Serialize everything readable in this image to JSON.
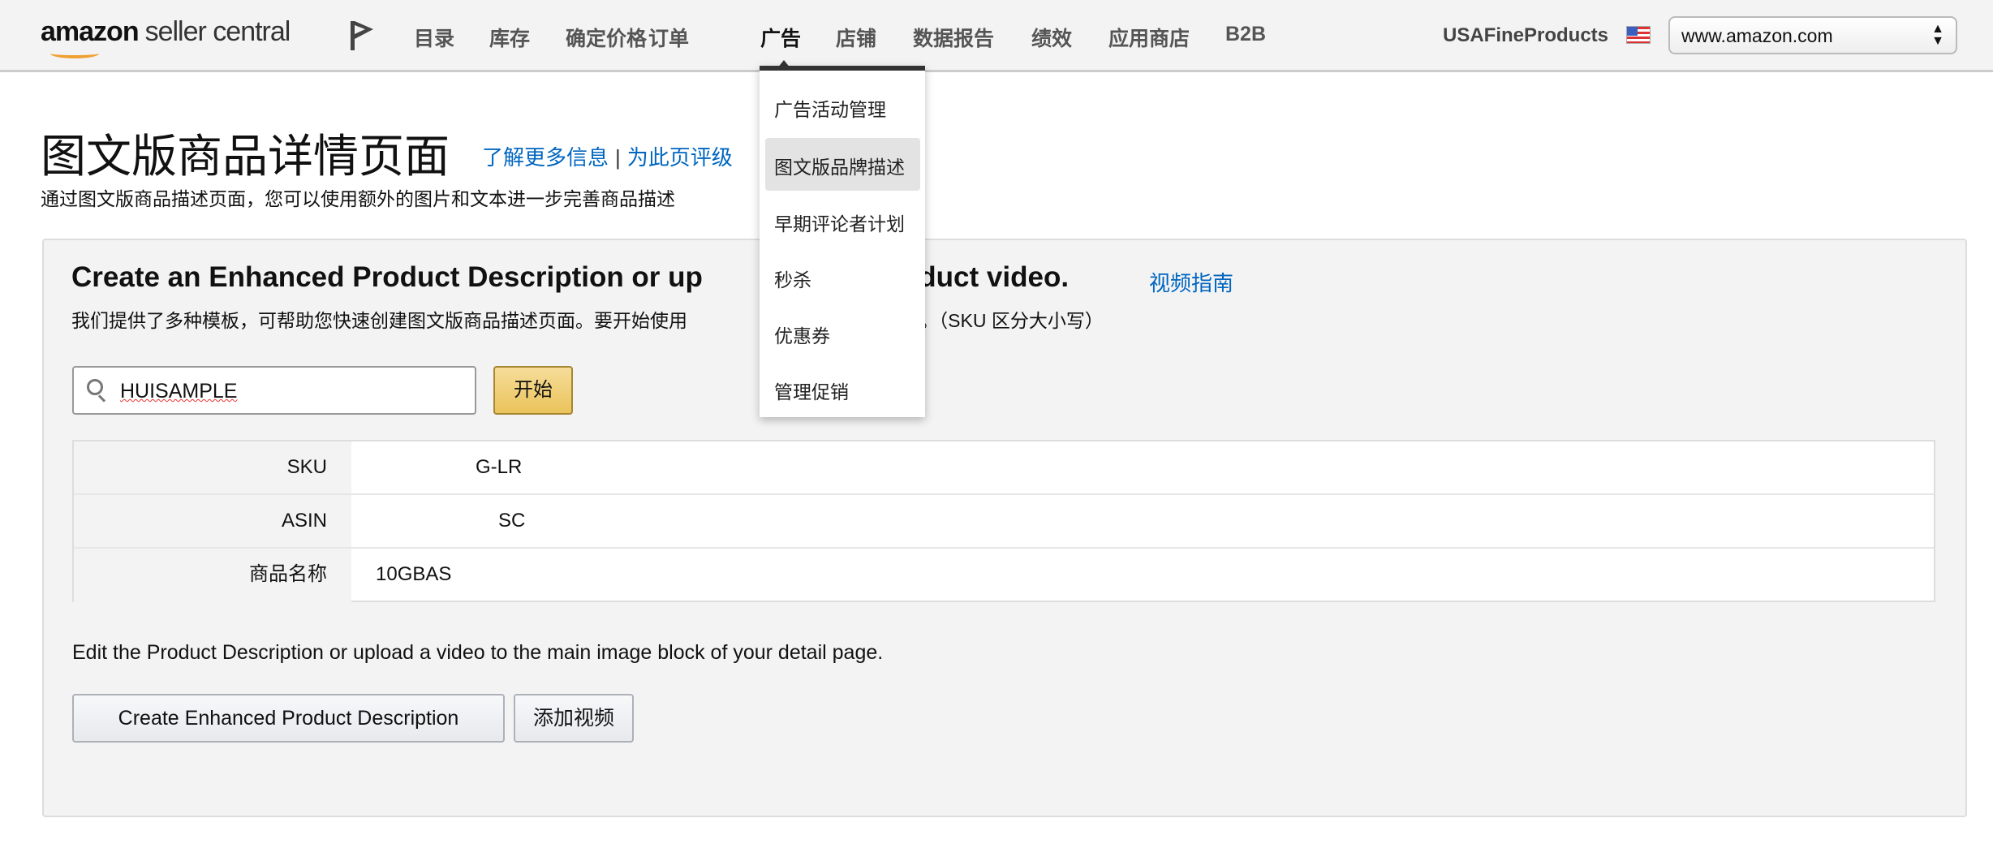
{
  "nav": {
    "logo": "amazon seller central",
    "logo_brand": "amazon",
    "logo_product": "seller central",
    "items": [
      "目录",
      "库存",
      "确定价格",
      "订单",
      "广告",
      "店铺",
      "数据报告",
      "绩效",
      "应用商店",
      "B2B"
    ],
    "active": "广告",
    "store_name": "USAFineProducts",
    "marketplace": "www.amazon.com"
  },
  "dropdown": {
    "items": [
      "广告活动管理",
      "图文版品牌描述",
      "早期评论者计划",
      "秒杀",
      "优惠券",
      "管理促销"
    ],
    "highlighted": "图文版品牌描述"
  },
  "page": {
    "title": "图文版商品详情页面",
    "link_learn": "了解更多信息",
    "separator": "|",
    "link_rate": "为此页评级",
    "subtitle": "通过图文版商品描述页面，您可以使用额外的图片和文本进一步完善商品描述"
  },
  "panel": {
    "heading_left": "Create an Enhanced Product Description or up",
    "heading_right": "product video.",
    "video_guide": "视频指南",
    "desc_left": "我们提供了多种模板，可帮助您快速创建图文版商品描述页面。要开始使用",
    "desc_right": "的 SKU。（SKU 区分大小写）",
    "search_value": "HUISAMPLE",
    "start_button": "开始",
    "rows": [
      {
        "label": "SKU",
        "value": "G-LR"
      },
      {
        "label": "ASIN",
        "value": "SC"
      },
      {
        "label": "商品名称",
        "value": "10GBAS"
      }
    ],
    "edit_text": "Edit the Product Description or upload a video to the main image block of your detail page.",
    "create_button": "Create Enhanced Product Description",
    "add_video_button": "添加视频"
  },
  "colors": {
    "link": "#0066c0",
    "button_primary": "#eac35a",
    "nav_bg": "#f3f3f3"
  }
}
